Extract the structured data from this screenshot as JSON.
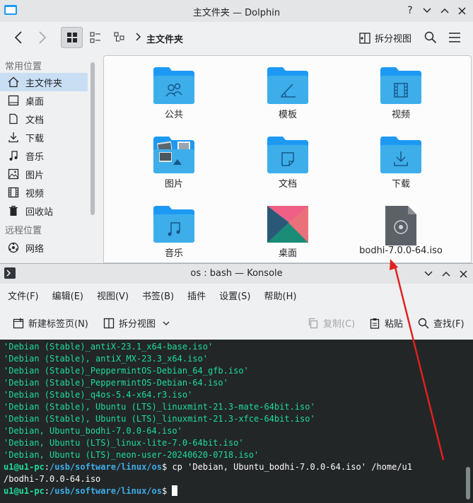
{
  "dolphin": {
    "title": "主文件夹 — Dolphin",
    "breadcrumb": "主文件夹",
    "split_view": "拆分视图",
    "places": {
      "header": "常用位置",
      "items": [
        {
          "label": "主文件夹",
          "icon": "home-icon"
        },
        {
          "label": "桌面",
          "icon": "desktop-icon"
        },
        {
          "label": "文档",
          "icon": "document-icon"
        },
        {
          "label": "下载",
          "icon": "download-icon"
        },
        {
          "label": "音乐",
          "icon": "music-icon"
        },
        {
          "label": "图片",
          "icon": "picture-icon"
        },
        {
          "label": "视频",
          "icon": "video-icon"
        },
        {
          "label": "回收站",
          "icon": "trash-icon"
        }
      ],
      "remote_header": "远程位置",
      "remote_items": [
        {
          "label": "网络",
          "icon": "network-icon"
        }
      ]
    },
    "files": [
      {
        "label": "公共",
        "icon": "folder-public-icon"
      },
      {
        "label": "模板",
        "icon": "folder-templates-icon"
      },
      {
        "label": "视频",
        "icon": "folder-videos-icon"
      },
      {
        "label": "图片",
        "icon": "folder-pictures-icon"
      },
      {
        "label": "文档",
        "icon": "folder-documents-icon"
      },
      {
        "label": "下载",
        "icon": "folder-downloads-icon"
      },
      {
        "label": "音乐",
        "icon": "folder-music-icon"
      },
      {
        "label": "桌面",
        "icon": "folder-desktop-icon"
      },
      {
        "label": "bodhi-7.0.0-64.iso",
        "icon": "disc-image-icon"
      }
    ]
  },
  "konsole": {
    "title": "os : bash — Konsole",
    "menu": [
      "文件(F)",
      "编辑(E)",
      "视图(V)",
      "书签(B)",
      "插件",
      "设置(S)",
      "帮助(H)"
    ],
    "toolbar": {
      "new_tab": "新建标签页(N)",
      "split_view": "拆分视图",
      "copy": "复制(C)",
      "paste": "粘贴",
      "find": "查找(F)"
    },
    "terminal": {
      "lines": [
        "'Debian (Stable)_antiX-23.1_x64-base.iso'",
        "'Debian (Stable), antiX_MX-23.3_x64.iso'",
        "'Debian (Stable)_PeppermintOS-Debian_64_gfb.iso'",
        "'Debian (Stable)_PeppermintOS-Debian-64.iso'",
        "'Debian (Stable)_q4os-5.4-x64.r3.iso'",
        "'Debian (Stable), Ubuntu (LTS)_linuxmint-21.3-mate-64bit.iso'",
        "'Debian (Stable), Ubuntu (LTS)_linuxmint-21.3-xfce-64bit.iso'",
        "'Debian, Ubuntu_bodhi-7.0.0-64.iso'",
        "'Debian, Ubuntu (LTS)_linux-lite-7.0-64bit.iso'",
        "'Debian, Ubuntu (LTS)_neon-user-20240620-0718.iso'"
      ],
      "prompt_user": "u1@u1-pc",
      "prompt_path": "/usb/software/linux/os",
      "command": " cp 'Debian, Ubuntu_bodhi-7.0.0-64.iso' /home/u1",
      "command_wrap": "/bodhi-7.0.0-64.iso"
    }
  },
  "colors": {
    "folder": "#1d99f3",
    "folder_light": "#3daee9",
    "annotation_arrow": "#e02020",
    "terminal_bg": "#232627",
    "terminal_green": "#1cdc9a"
  }
}
